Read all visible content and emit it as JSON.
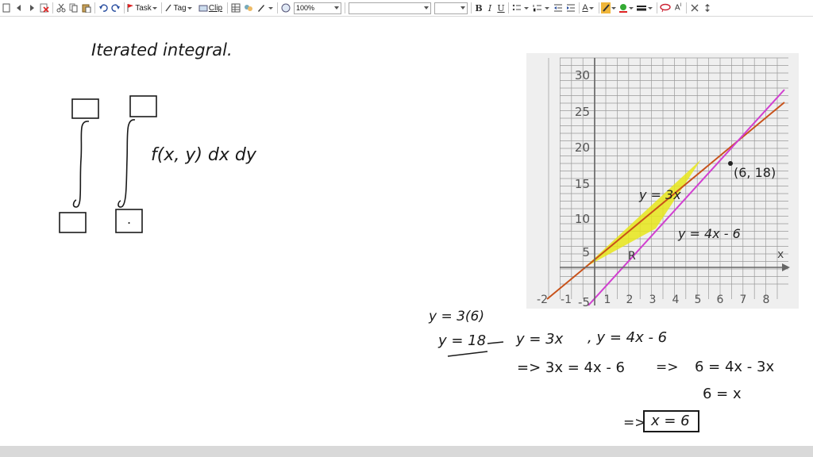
{
  "toolbar": {
    "task_label": "Task",
    "tag_label": "Tag",
    "clip_label": "Clip",
    "zoom_value": "100%",
    "font_value": "",
    "size_value": "",
    "bold": "B",
    "italic": "I",
    "underline": "U",
    "text_color_glyph": "A",
    "icons": [
      "page-icon",
      "back-icon",
      "forward-icon",
      "delete-icon",
      "cut-icon",
      "copy-icon",
      "paste-icon",
      "undo-icon",
      "redo-icon",
      "task-flag-icon",
      "tag-icon",
      "clip-icon",
      "table-icon",
      "ink-icon",
      "pen-icon",
      "globe-icon",
      "bullet-list-icon",
      "number-list-icon",
      "outdent-icon",
      "indent-icon",
      "text-color-icon",
      "highlighter-icon",
      "pen-color-icon",
      "line-style-icon",
      "lasso-icon",
      "ink-to-text-icon",
      "close-icon",
      "arrange-icon"
    ]
  },
  "note": {
    "title": "Iterated integral.",
    "integrand": "f(x, y)  dx dy",
    "bound_dot": "."
  },
  "graph": {
    "y_ticks": [
      "30",
      "25",
      "20",
      "15",
      "10",
      "5",
      "-5"
    ],
    "x_ticks": [
      "-2",
      "-1",
      "1",
      "2",
      "3",
      "4",
      "5",
      "6",
      "7",
      "8"
    ],
    "x_axis_label": "x",
    "line1_label": "y = 3x",
    "line2_label": "y = 4x - 6",
    "point_label": "(6, 18)",
    "region_label": "R",
    "colors": {
      "line1": "#c8521a",
      "line2": "#d13fd0",
      "region": "#e8e61a",
      "grid": "#9a9a9a",
      "background": "#efefef"
    }
  },
  "work": {
    "line1": "y = 3(6)",
    "line2": "y = 18",
    "line3a": "y = 3x",
    "line3b": ", y = 4x - 6",
    "line4a": "=> 3x = 4x - 6",
    "line4b": "=>",
    "line4c": "6 = 4x - 3x",
    "line5": "6 = x",
    "line6a": "=>",
    "line6b": "x = 6"
  }
}
